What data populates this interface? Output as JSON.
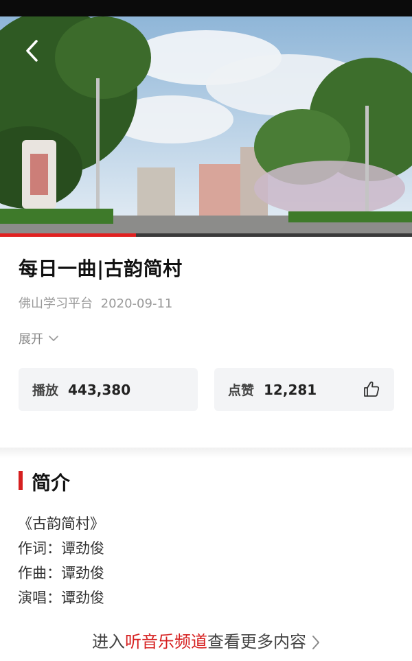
{
  "video": {
    "progress": 0.33
  },
  "article": {
    "title": "每日一曲|古韵简村",
    "source": "佛山学习平台",
    "date": "2020-09-11",
    "expand_label": "展开"
  },
  "stats": {
    "play_label": "播放",
    "play_count": "443,380",
    "like_label": "点赞",
    "like_count": "12,281"
  },
  "intro": {
    "heading": "简介",
    "lines": [
      "《古韵简村》",
      "作词：谭劲俊",
      "作曲：谭劲俊",
      "演唱：谭劲俊"
    ]
  },
  "footer": {
    "prefix": "进入",
    "channel": "听音乐频道",
    "suffix": "查看更多内容"
  },
  "colors": {
    "accent": "#d62020",
    "card_bg": "#f3f4f6"
  },
  "icons": {
    "back": "back-arrow-icon",
    "expand": "chevron-down-icon",
    "like": "thumbs-up-icon",
    "more": "chevron-right-icon"
  }
}
